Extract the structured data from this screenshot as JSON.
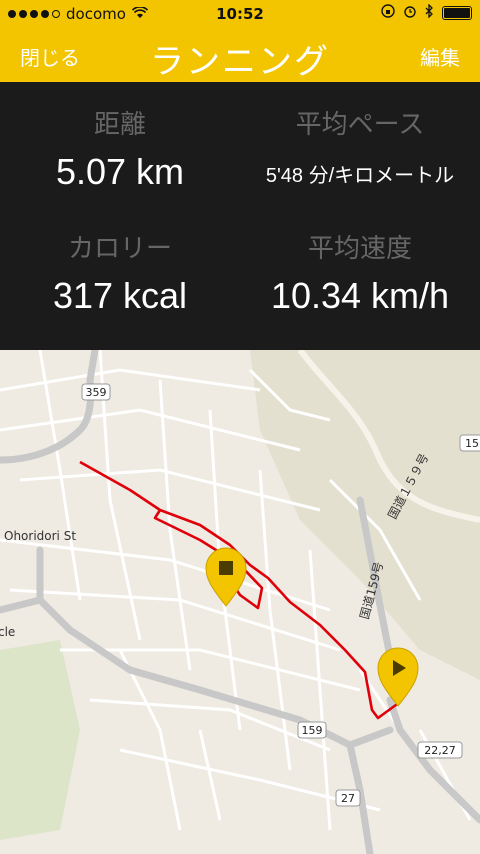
{
  "status": {
    "carrier": "docomo",
    "time": "10:52",
    "signal_dots": 4
  },
  "nav": {
    "close_label": "閉じる",
    "title": "ランニング",
    "edit_label": "編集"
  },
  "stats": {
    "distance_label": "距離",
    "distance_value": "5.07 km",
    "pace_label": "平均ペース",
    "pace_value": "5'48 分/キロメートル",
    "calories_label": "カロリー",
    "calories_value": "317 kcal",
    "speed_label": "平均速度",
    "speed_value": "10.34 km/h"
  },
  "map": {
    "street_label_1": "Ohoridori St",
    "street_label_2": "cle",
    "route_label_1": "国道１５９号",
    "route_label_2": "国道159号",
    "shield_359": "359",
    "shield_159": "159",
    "shield_15": "15",
    "shield_2227": "22,27",
    "shield_27": "27",
    "accent_color": "#f2c500",
    "route_color": "#e0000a"
  }
}
